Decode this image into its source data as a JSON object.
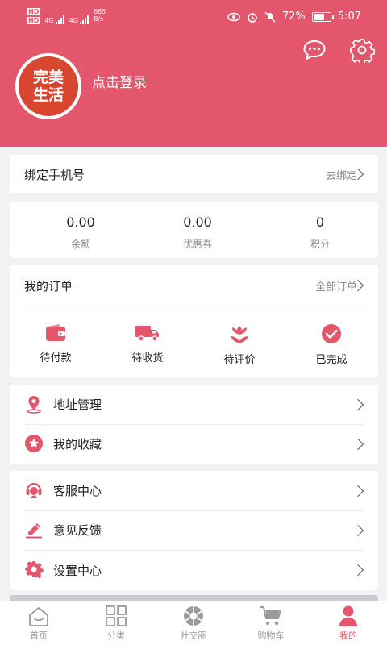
{
  "status_bar": {
    "network_badges": [
      "HD",
      "HD"
    ],
    "net_types": [
      "4G",
      "4G"
    ],
    "speed_value": "665",
    "speed_unit": "B/s",
    "battery": "72%",
    "battery_level": 0.72,
    "time": "5:07"
  },
  "header": {
    "logo_line1": "完美",
    "logo_line2": "生活",
    "login": "点击登录",
    "message_icon": "chat-bubble-icon",
    "settings_icon": "gear-icon"
  },
  "bind_phone": {
    "title": "绑定手机号",
    "action": "去绑定"
  },
  "stats": [
    {
      "value": "0.00",
      "label": "余额"
    },
    {
      "value": "0.00",
      "label": "优惠券"
    },
    {
      "value": "0",
      "label": "积分"
    }
  ],
  "orders": {
    "title": "我的订单",
    "all": "全部订单",
    "items": [
      {
        "label": "待付款",
        "icon": "wallet-icon"
      },
      {
        "label": "待收货",
        "icon": "truck-icon"
      },
      {
        "label": "待评价",
        "icon": "flower-icon"
      },
      {
        "label": "已完成",
        "icon": "check-circle-icon"
      }
    ]
  },
  "list_group1": [
    {
      "label": "地址管理",
      "icon": "location-pin-icon"
    },
    {
      "label": "我的收藏",
      "icon": "star-icon"
    }
  ],
  "list_group2": [
    {
      "label": "客服中心",
      "icon": "headset-icon"
    },
    {
      "label": "意见反馈",
      "icon": "feedback-pen-icon"
    },
    {
      "label": "设置中心",
      "icon": "gear-icon"
    }
  ],
  "tabs": [
    {
      "label": "首页",
      "icon": "home-icon"
    },
    {
      "label": "分类",
      "icon": "grid-icon"
    },
    {
      "label": "社交圈",
      "icon": "aperture-icon"
    },
    {
      "label": "购物车",
      "icon": "cart-icon"
    },
    {
      "label": "我的",
      "icon": "user-icon",
      "active": true
    }
  ],
  "colors": {
    "accent": "#e3566c",
    "background": "#f2f2f2"
  }
}
